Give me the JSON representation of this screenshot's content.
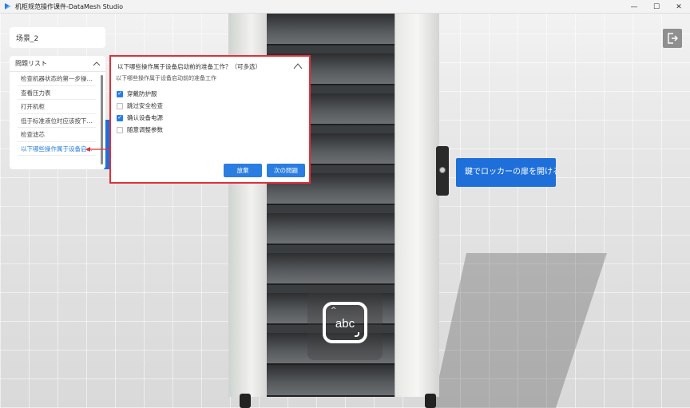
{
  "window": {
    "title": "机柜规范操作课件-DataMesh Studio",
    "controls": {
      "minimize": "—",
      "maximize": "☐",
      "close": "✕"
    }
  },
  "scene": {
    "name": "场景_2",
    "locker_tooltip": "鍵でロッカーの扉を開ける"
  },
  "question_list": {
    "header": "問題リスト",
    "items": [
      {
        "label": "检查机器状态的第一步操作…",
        "active": false
      },
      {
        "label": "查看压力表",
        "active": false
      },
      {
        "label": "打开机柜",
        "active": false
      },
      {
        "label": "低于标准液位时应该按下哪…",
        "active": false
      },
      {
        "label": "检查滤芯",
        "active": false
      },
      {
        "label": "以下哪些操作属于设备启…",
        "active": true
      }
    ]
  },
  "quiz": {
    "title": "以下哪些操作属于设备启动前的准备工作？（可多选）",
    "subtitle": "以下哪些操作属于设备启动前的准备工作",
    "options": [
      {
        "label": "穿戴防护服",
        "checked": true
      },
      {
        "label": "跳过安全检查",
        "checked": false
      },
      {
        "label": "确认设备电源",
        "checked": true
      },
      {
        "label": "随意调整参数",
        "checked": false
      }
    ],
    "give_up_label": "放棄",
    "next_label": "次の問題"
  },
  "keyboard_overlay": {
    "label": "abc"
  },
  "colors": {
    "accent": "#2a7de1",
    "highlight_border": "#e0303a"
  }
}
